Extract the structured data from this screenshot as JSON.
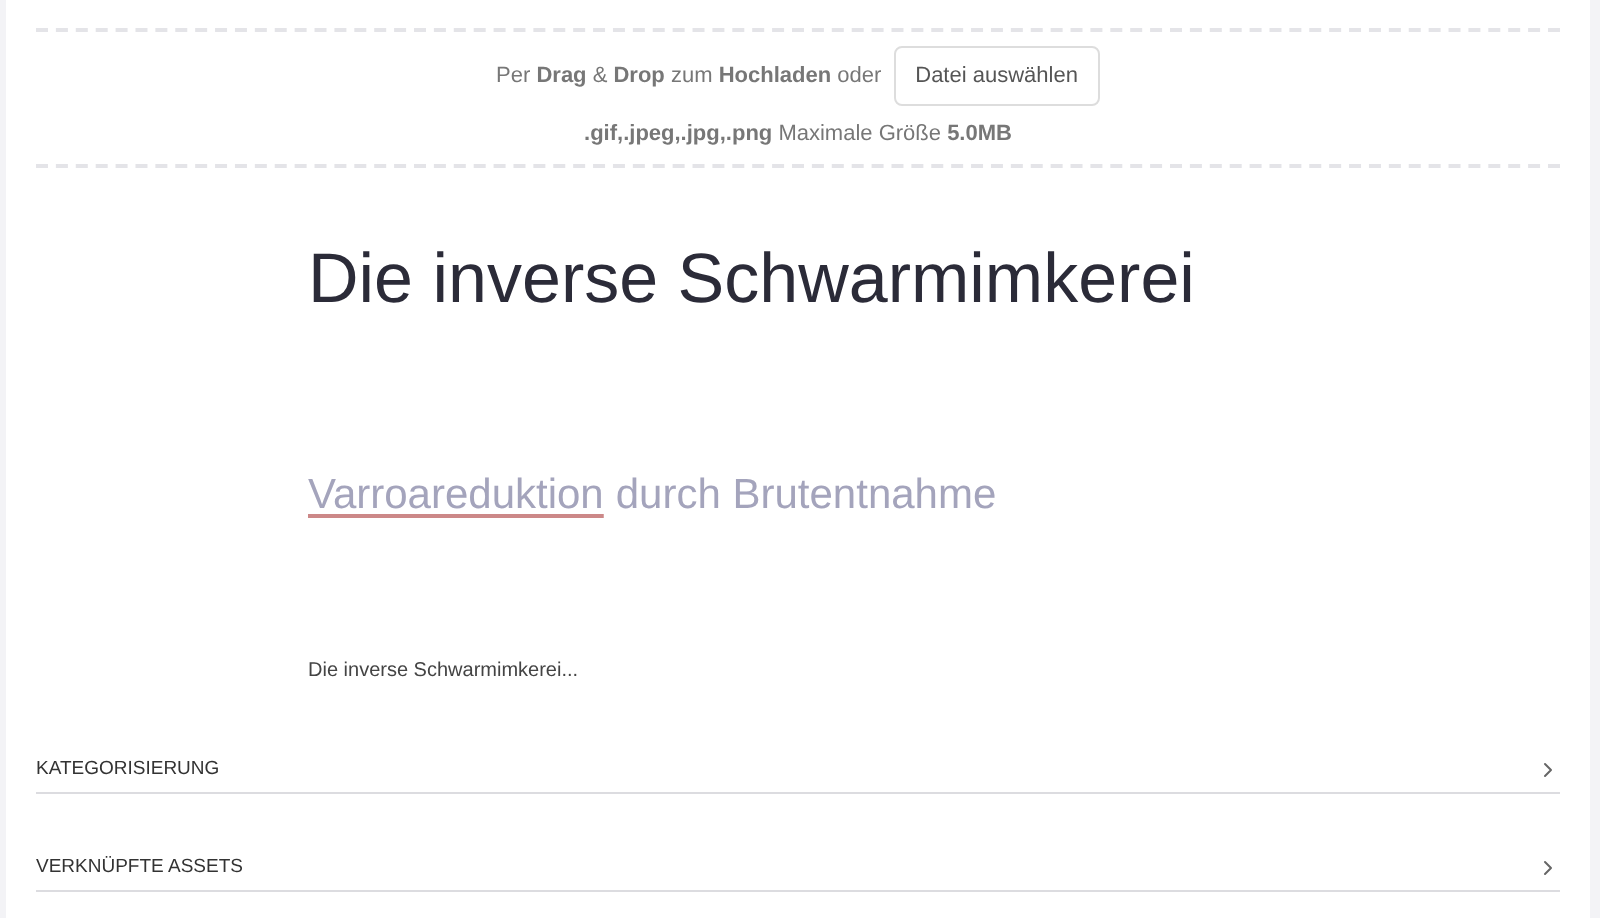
{
  "upload": {
    "prompt": "Per **Drag** & **Drop** zum **Hochladen** oder",
    "button": "Datei auswählen",
    "formats": "**.gif,.jpeg,.jpg,.png** Maximale Größe **5.0MB**"
  },
  "title": "Die inverse Schwarmimkerei",
  "subtitle": {
    "marked_word": "Varroareduktion",
    "rest": "durch Brutentnahme"
  },
  "excerpt": "Die inverse Schwarmimkerei...",
  "sections": [
    {
      "label": "KATEGORISIERUNG",
      "expanded": false
    },
    {
      "label": "VERKNÜPFTE ASSETS",
      "expanded": false
    }
  ]
}
